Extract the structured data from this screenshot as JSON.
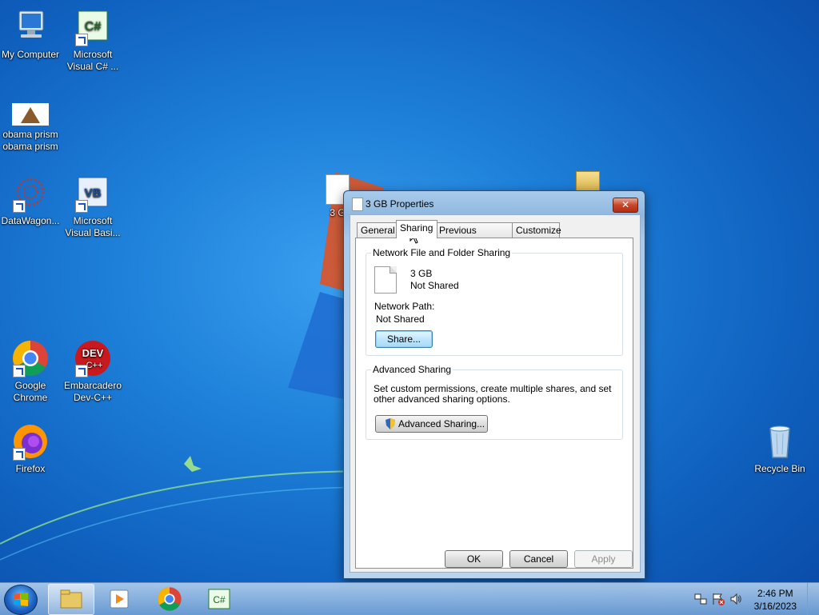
{
  "desktop": {
    "icons": [
      {
        "label": "My Computer"
      },
      {
        "label": "Microsoft Visual C# ..."
      },
      {
        "label": "obama prism obama prism"
      },
      {
        "label": "DataWagon..."
      },
      {
        "label": "Microsoft Visual Basi..."
      },
      {
        "label": "Google Chrome"
      },
      {
        "label": "Embarcadero Dev-C++"
      },
      {
        "label": "Firefox"
      },
      {
        "label": "Recycle Bin"
      }
    ],
    "partial_label": "3 G"
  },
  "dialog": {
    "title": "3 GB Properties",
    "close_label": "✕",
    "tabs": [
      {
        "label": "General"
      },
      {
        "label": "Sharing",
        "active": true
      },
      {
        "label": "Previous Versions"
      },
      {
        "label": "Customize"
      }
    ],
    "network": {
      "group_title": "Network File and Folder Sharing",
      "file_name": "3 GB",
      "file_status": "Not Shared",
      "path_label": "Network Path:",
      "path_value": "Not Shared",
      "share_button": "Share..."
    },
    "advanced": {
      "group_title": "Advanced Sharing",
      "description": "Set custom permissions, create multiple shares, and set other advanced sharing options.",
      "button": "Advanced Sharing..."
    },
    "footer": {
      "ok": "OK",
      "cancel": "Cancel",
      "apply": "Apply"
    }
  },
  "taskbar": {
    "time": "2:46 PM",
    "date": "3/16/2023"
  },
  "colors": {
    "accent": "#1a5fbf",
    "close_red": "#c7462a"
  }
}
